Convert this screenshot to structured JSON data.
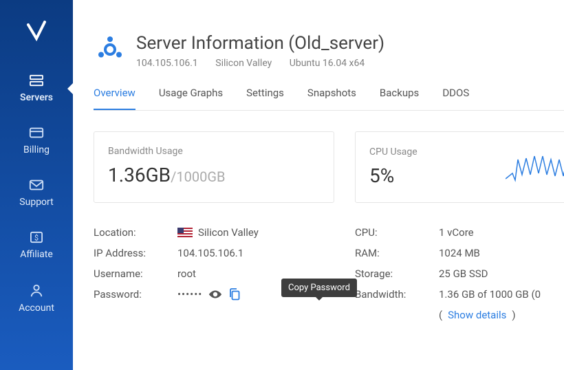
{
  "sidebar": {
    "items": [
      {
        "label": "Servers"
      },
      {
        "label": "Billing"
      },
      {
        "label": "Support"
      },
      {
        "label": "Affiliate"
      },
      {
        "label": "Account"
      }
    ]
  },
  "header": {
    "title": "Server Information (Old_server)",
    "ip": "104.105.106.1",
    "location": "Silicon Valley",
    "os": "Ubuntu 16.04 x64"
  },
  "tabs": [
    {
      "label": "Overview"
    },
    {
      "label": "Usage Graphs"
    },
    {
      "label": "Settings"
    },
    {
      "label": "Snapshots"
    },
    {
      "label": "Backups"
    },
    {
      "label": "DDOS"
    }
  ],
  "cards": {
    "bandwidth": {
      "title": "Bandwidth Usage",
      "used": "1.36GB",
      "total": "/1000GB"
    },
    "cpu": {
      "title": "CPU Usage",
      "value": "5%"
    }
  },
  "details": {
    "left": {
      "location_label": "Location:",
      "location_value": "Silicon Valley",
      "ip_label": "IP Address:",
      "ip_value": "104.105.106.1",
      "username_label": "Username:",
      "username_value": "root",
      "password_label": "Password:",
      "password_masked": "••••••"
    },
    "right": {
      "cpu_label": "CPU:",
      "cpu_value": "1 vCore",
      "ram_label": "RAM:",
      "ram_value": "1024 MB",
      "storage_label": "Storage:",
      "storage_value": "25 GB SSD",
      "bandwidth_label": "Bandwidth:",
      "bandwidth_value": "1.36 GB of 1000 GB (0",
      "show_details": "(",
      "show_details_link": "Show details",
      "show_details_close": ")"
    }
  },
  "tooltip": {
    "copy_password": "Copy Password"
  }
}
